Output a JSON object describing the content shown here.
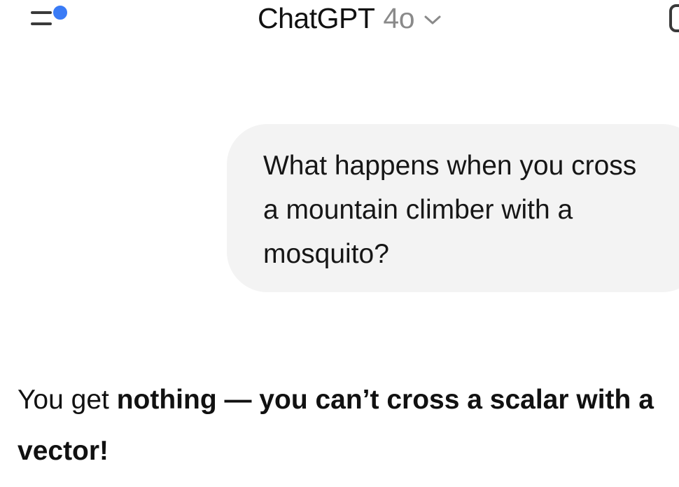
{
  "header": {
    "app_title": "ChatGPT",
    "model_name": "4o",
    "icons": {
      "menu": "menu-icon",
      "notification": "notification-dot-icon",
      "chevron": "chevron-down-icon",
      "new_chat": "new-chat-icon"
    },
    "notification_color": "#3a7bf6"
  },
  "conversation": {
    "user_message": "What happens when you cross\na mountain climber with a\nmosquito?",
    "assistant_message": {
      "prefix": "You get ",
      "bold": "nothing — you can’t cross a scalar with a vector!"
    }
  }
}
